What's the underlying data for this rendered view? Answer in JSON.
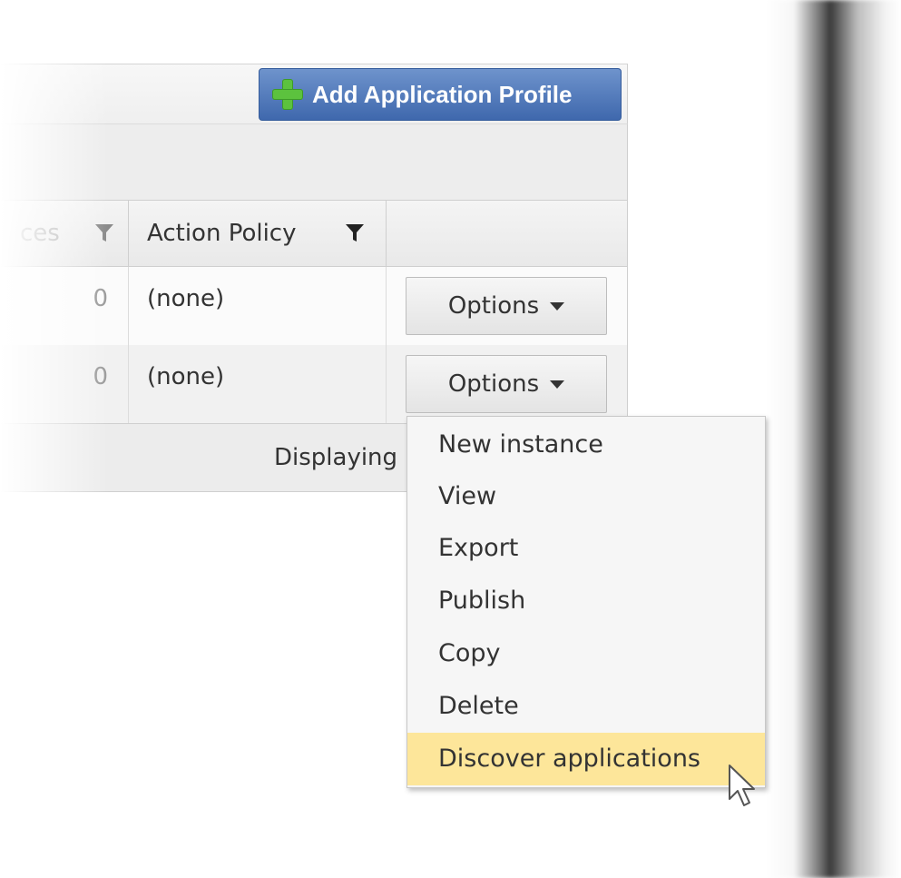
{
  "toolbar": {
    "add_button_label": "Add Application Profile"
  },
  "table": {
    "columns": [
      {
        "label": "ces",
        "has_filter": true
      },
      {
        "label": "Action Policy",
        "has_filter": true
      },
      {
        "label": ""
      }
    ],
    "rows": [
      {
        "count": "0",
        "policy": "(none)",
        "options_label": "Options"
      },
      {
        "count": "0",
        "policy": "(none)",
        "options_label": "Options"
      }
    ],
    "footer_text": "Displaying"
  },
  "menu": {
    "items": [
      {
        "label": "New instance"
      },
      {
        "label": "View"
      },
      {
        "label": "Export"
      },
      {
        "label": "Publish"
      },
      {
        "label": "Copy"
      },
      {
        "label": "Delete"
      },
      {
        "label": "Discover applications",
        "highlighted": true
      }
    ]
  },
  "colors": {
    "accent_blue": "#4a72b4",
    "plus_green": "#5cc23e",
    "highlight_yellow": "#fde69a"
  }
}
